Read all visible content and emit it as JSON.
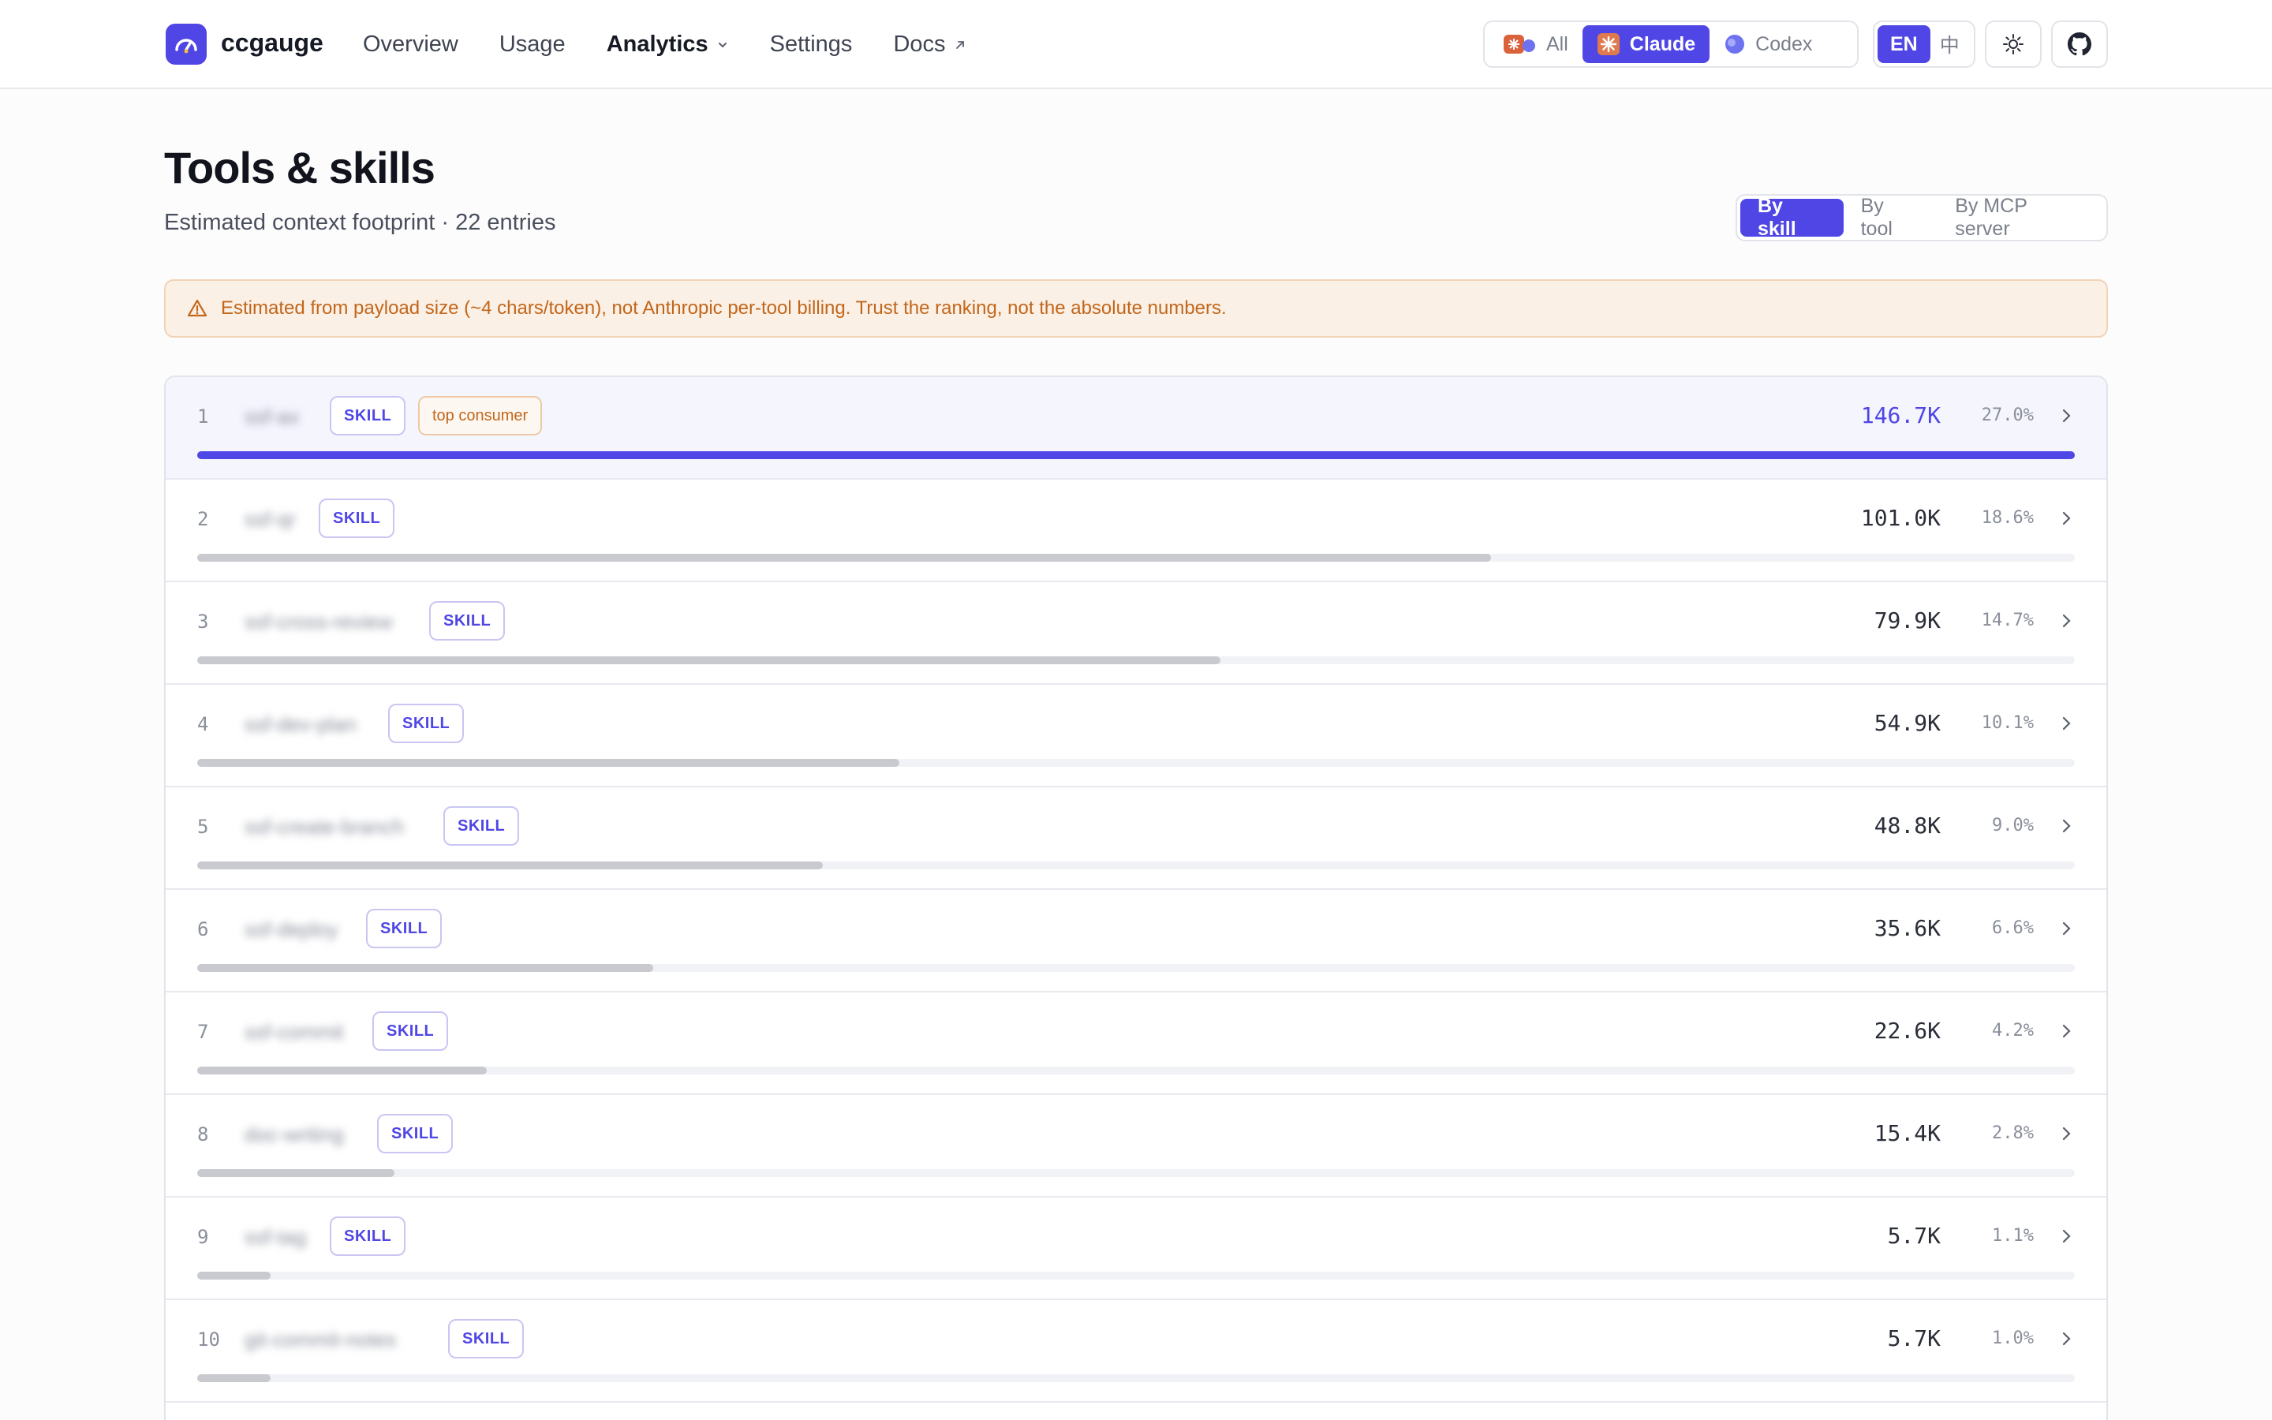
{
  "app": {
    "name": "ccgauge"
  },
  "nav": [
    {
      "label": "Overview"
    },
    {
      "label": "Usage"
    },
    {
      "label": "Analytics",
      "has_dropdown": true,
      "active": true
    },
    {
      "label": "Settings"
    },
    {
      "label": "Docs",
      "external": true
    }
  ],
  "source_filter": {
    "options": [
      {
        "label": "All"
      },
      {
        "label": "Claude"
      },
      {
        "label": "Codex"
      }
    ],
    "selected": "Claude"
  },
  "language": {
    "options": [
      {
        "label": "EN"
      },
      {
        "label": "中"
      }
    ],
    "selected": "EN"
  },
  "icons": {
    "theme": "sun-icon",
    "github": "github-icon"
  },
  "page": {
    "title": "Tools & skills",
    "subtitle": "Estimated context footprint · 22 entries"
  },
  "view": {
    "options": [
      {
        "label": "By skill"
      },
      {
        "label": "By tool"
      },
      {
        "label": "By MCP server"
      }
    ],
    "selected": "By skill"
  },
  "warning": "Estimated from payload size (~4 chars/token), not Anthropic per-tool billing. Trust the ranking, not the absolute numbers.",
  "colors": {
    "accent": "#4f46e5",
    "warning": "#c2661a",
    "bar": "#c9cad0"
  },
  "rows": [
    {
      "rank": "1",
      "name": "ssf-ax",
      "badge": "SKILL",
      "extra_badge": "top consumer",
      "value": "146.7K",
      "percent": "27.0%",
      "share": 1.0
    },
    {
      "rank": "2",
      "name": "ssf-qr",
      "badge": "SKILL",
      "value": "101.0K",
      "percent": "18.6%",
      "share": 0.689
    },
    {
      "rank": "3",
      "name": "ssf-cross-review",
      "badge": "SKILL",
      "value": "79.9K",
      "percent": "14.7%",
      "share": 0.545
    },
    {
      "rank": "4",
      "name": "ssf-dev-plan",
      "badge": "SKILL",
      "value": "54.9K",
      "percent": "10.1%",
      "share": 0.374
    },
    {
      "rank": "5",
      "name": "ssf-create-branch",
      "badge": "SKILL",
      "value": "48.8K",
      "percent": "9.0%",
      "share": 0.333
    },
    {
      "rank": "6",
      "name": "ssf-deploy",
      "badge": "SKILL",
      "value": "35.6K",
      "percent": "6.6%",
      "share": 0.243
    },
    {
      "rank": "7",
      "name": "ssf-commit",
      "badge": "SKILL",
      "value": "22.6K",
      "percent": "4.2%",
      "share": 0.154
    },
    {
      "rank": "8",
      "name": "doc-writing",
      "badge": "SKILL",
      "value": "15.4K",
      "percent": "2.8%",
      "share": 0.105
    },
    {
      "rank": "9",
      "name": "ssf-tag",
      "badge": "SKILL",
      "value": "5.7K",
      "percent": "1.1%",
      "share": 0.039
    },
    {
      "rank": "10",
      "name": "git-commit-notes",
      "badge": "SKILL",
      "value": "5.7K",
      "percent": "1.0%",
      "share": 0.039
    }
  ]
}
